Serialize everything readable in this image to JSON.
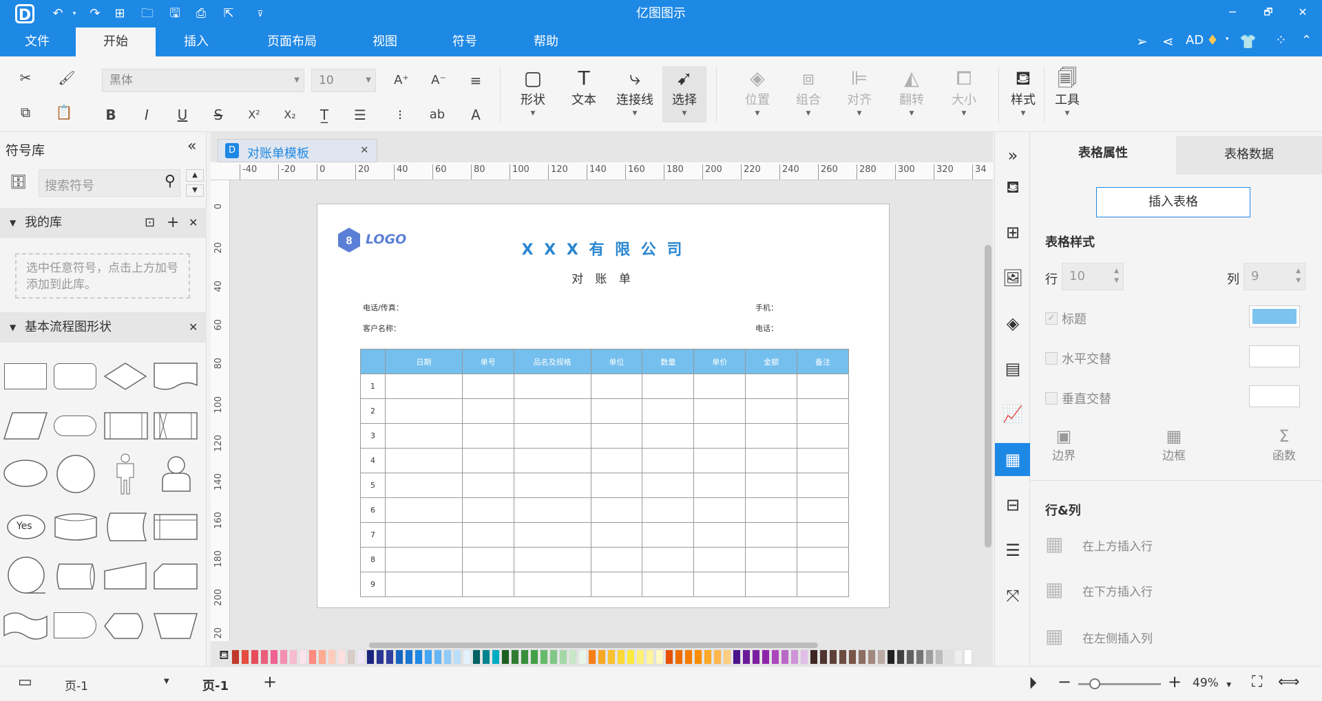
{
  "app": {
    "title": "亿图图示",
    "logo": "D"
  },
  "window": {
    "minimize": "─",
    "restore": "🗗",
    "close": "✕"
  },
  "quick_access": [
    "undo-icon",
    "redo-icon",
    "new-icon",
    "open-icon",
    "save-icon",
    "print-icon",
    "export-icon",
    "customize-icon"
  ],
  "menu_tabs": [
    {
      "label": "文件"
    },
    {
      "label": "开始"
    },
    {
      "label": "插入"
    },
    {
      "label": "页面布局"
    },
    {
      "label": "视图"
    },
    {
      "label": "符号"
    },
    {
      "label": "帮助"
    }
  ],
  "account": {
    "user": "AD"
  },
  "ribbon": {
    "font_family": "黑体",
    "font_size": "10",
    "shape": "形状",
    "text": "文本",
    "connector": "连接线",
    "select": "选择",
    "position": "位置",
    "group": "组合",
    "align": "对齐",
    "flip": "翻转",
    "size": "大小",
    "style": "样式",
    "tools": "工具",
    "format_glyphs": {
      "bold": "B",
      "italic": "I",
      "underline": "U",
      "strike": "S",
      "sup": "X²",
      "sub": "X₂",
      "grow": "A⁺",
      "shrink": "A⁻",
      "case": "ab",
      "color": "A"
    }
  },
  "library": {
    "title": "符号库",
    "search_placeholder": "搜索符号",
    "my_library": "我的库",
    "my_library_hint": "选中任意符号，点击上方加号添加到此库。",
    "basic_flowchart": "基本流程图形状",
    "yes_label": "Yes"
  },
  "document": {
    "tab_label": "对账单模板",
    "logo_text": "LOGO",
    "company": "X X X 有 限 公 司",
    "doc_title": "对 账 单",
    "phone_fax_label": "电话/传真：",
    "mobile_label": "手机：",
    "customer_label": "客户名称：",
    "tel_label": "电话：",
    "table_headers": [
      "",
      "日期",
      "单号",
      "品名及规格",
      "单位",
      "数量",
      "单价",
      "金额",
      "备注"
    ],
    "row_numbers": [
      "1",
      "2",
      "3",
      "4",
      "5",
      "6",
      "7",
      "8",
      "9"
    ]
  },
  "ruler": {
    "h_ticks": [
      "-40",
      "-20",
      "0",
      "20",
      "40",
      "60",
      "80",
      "100",
      "120",
      "140",
      "160",
      "180",
      "200",
      "220",
      "240",
      "260",
      "280",
      "300",
      "320",
      "34"
    ],
    "v_ticks": [
      "0",
      "20",
      "40",
      "60",
      "80",
      "100",
      "120",
      "140",
      "160",
      "180",
      "200",
      "20"
    ]
  },
  "right_panel": {
    "tab_properties": "表格属性",
    "tab_data": "表格数据",
    "insert_table": "插入表格",
    "table_style": "表格样式",
    "rows_label": "行",
    "rows_value": "10",
    "cols_label": "列",
    "cols_value": "9",
    "header_label": "标题",
    "h_alternate": "水平交替",
    "v_alternate": "垂直交替",
    "boundary": "边界",
    "border": "边框",
    "function": "函数",
    "rows_cols": "行&列",
    "insert_above": "在上方插入行",
    "insert_below": "在下方插入行",
    "insert_left": "在左侧插入列",
    "header_color": "#7cc3f0"
  },
  "statusbar": {
    "page_select": "页-1",
    "page_tab": "页-1",
    "add_page": "+",
    "zoom": "49%",
    "zoom_fraction": 0.2
  },
  "palette": [
    "#c0392b",
    "#e74c3c",
    "#e84b5a",
    "#ec5f7c",
    "#f06292",
    "#f48fb1",
    "#f8bbd0",
    "#fce4ec",
    "#ff8a80",
    "#ffab91",
    "#ffccbc",
    "#ffe0e0",
    "#d7ccc8",
    "#ede7f6",
    "#1a237e",
    "#283593",
    "#303f9f",
    "#1565c0",
    "#1976d2",
    "#1e88e5",
    "#42a5f5",
    "#64b5f6",
    "#90caf9",
    "#bbdefb",
    "#e3f2fd",
    "#006064",
    "#00838f",
    "#00acc1",
    "#1b5e20",
    "#2e7d32",
    "#388e3c",
    "#43a047",
    "#66bb6a",
    "#81c784",
    "#a5d6a7",
    "#c8e6c9",
    "#e8f5e9",
    "#f57f17",
    "#f9a825",
    "#fbc02d",
    "#fdd835",
    "#ffeb3b",
    "#fff176",
    "#fff59d",
    "#fff9c4",
    "#e65100",
    "#ef6c00",
    "#f57c00",
    "#fb8c00",
    "#ffa726",
    "#ffb74d",
    "#ffcc80",
    "#4a148c",
    "#6a1b9a",
    "#7b1fa2",
    "#8e24aa",
    "#ab47bc",
    "#ba68c8",
    "#ce93d8",
    "#e1bee7",
    "#3e2723",
    "#4e342e",
    "#5d4037",
    "#6d4c41",
    "#795548",
    "#8d6e63",
    "#a1887f",
    "#bcaaa4",
    "#212121",
    "#424242",
    "#616161",
    "#757575",
    "#9e9e9e",
    "#bdbdbd",
    "#e0e0e0",
    "#eeeeee",
    "#ffffff"
  ]
}
